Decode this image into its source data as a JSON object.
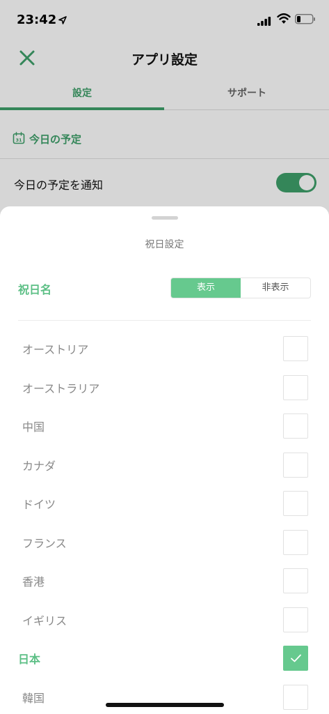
{
  "status_bar": {
    "time": "23:42"
  },
  "nav": {
    "title": "アプリ設定"
  },
  "tabs": [
    {
      "label": "設定",
      "active": true
    },
    {
      "label": "サポート",
      "active": false
    }
  ],
  "section": {
    "title": "今日の予定",
    "calendar_day": "31"
  },
  "notify": {
    "label": "今日の予定を通知",
    "enabled": true
  },
  "sheet": {
    "title": "祝日設定",
    "holiday_name_label": "祝日名",
    "segment": {
      "show": "表示",
      "hide": "非表示",
      "selected": "show"
    },
    "countries": [
      {
        "name": "オーストリア",
        "checked": false
      },
      {
        "name": "オーストラリア",
        "checked": false
      },
      {
        "name": "中国",
        "checked": false
      },
      {
        "name": "カナダ",
        "checked": false
      },
      {
        "name": "ドイツ",
        "checked": false
      },
      {
        "name": "フランス",
        "checked": false
      },
      {
        "name": "香港",
        "checked": false
      },
      {
        "name": "イギリス",
        "checked": false
      },
      {
        "name": "日本",
        "checked": true
      },
      {
        "name": "韓国",
        "checked": false
      }
    ]
  },
  "colors": {
    "accent": "#3fa06a",
    "accent_light": "#66c98e"
  }
}
